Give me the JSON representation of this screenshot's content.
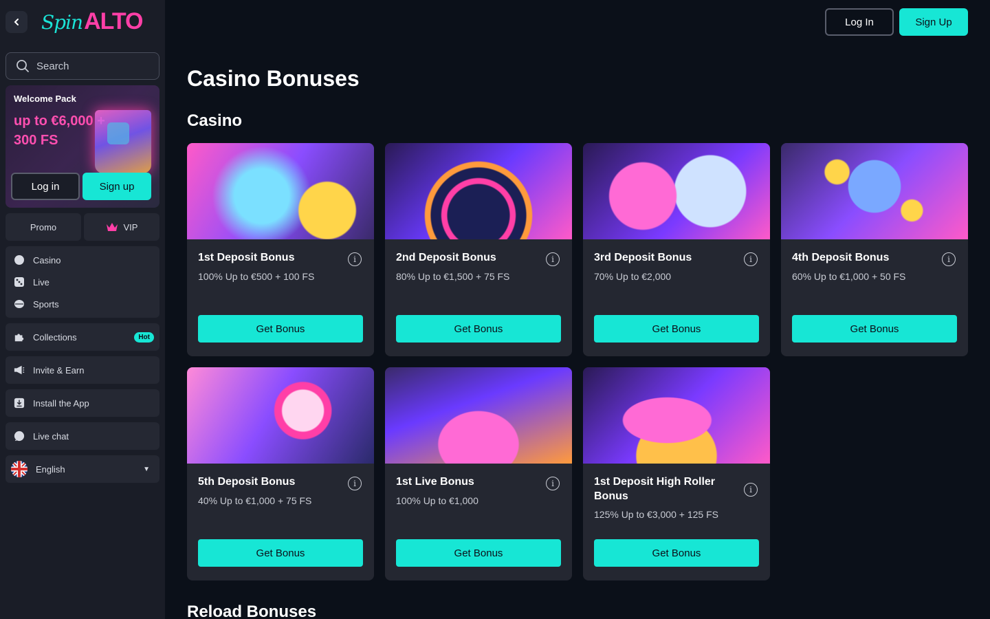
{
  "sidebar": {
    "logo_spin": "Spin",
    "logo_alto": "ALTO",
    "search_placeholder": "Search",
    "welcome": {
      "title": "Welcome Pack",
      "amount": "up to €6,000 + 300 FS",
      "login_label": "Log in",
      "signup_label": "Sign up"
    },
    "tabs": {
      "promo": "Promo",
      "vip": "VIP"
    },
    "games": [
      {
        "label": "Casino",
        "icon": "chip-icon"
      },
      {
        "label": "Live",
        "icon": "dice-icon"
      },
      {
        "label": "Sports",
        "icon": "ball-icon"
      }
    ],
    "collections": {
      "label": "Collections",
      "badge": "Hot"
    },
    "invite": "Invite & Earn",
    "install": "Install the App",
    "livechat": "Live chat",
    "language": "English"
  },
  "header": {
    "login_label": "Log In",
    "signup_label": "Sign Up"
  },
  "main": {
    "title": "Casino Bonuses",
    "section_casino": "Casino",
    "section_reload": "Reload Bonuses",
    "cta_label": "Get Bonus",
    "cards": [
      {
        "title": "1st Deposit Bonus",
        "desc": "100% Up to €500 + 100 FS"
      },
      {
        "title": "2nd Deposit Bonus",
        "desc": "80% Up to €1,500 + 75 FS"
      },
      {
        "title": "3rd Deposit Bonus",
        "desc": "70% Up to €2,000"
      },
      {
        "title": "4th Deposit Bonus",
        "desc": "60% Up to €1,000 + 50 FS"
      },
      {
        "title": "5th Deposit Bonus",
        "desc": "40% Up to €1,000 + 75 FS"
      },
      {
        "title": "1st Live Bonus",
        "desc": "100% Up to €1,000"
      },
      {
        "title": "1st Deposit High Roller Bonus",
        "desc": "125% Up to €3,000 + 125 FS"
      }
    ]
  },
  "colors": {
    "accent": "#17e6d5",
    "brand_pink": "#ff3fa7",
    "bg": "#0b1019",
    "card": "#242731"
  }
}
